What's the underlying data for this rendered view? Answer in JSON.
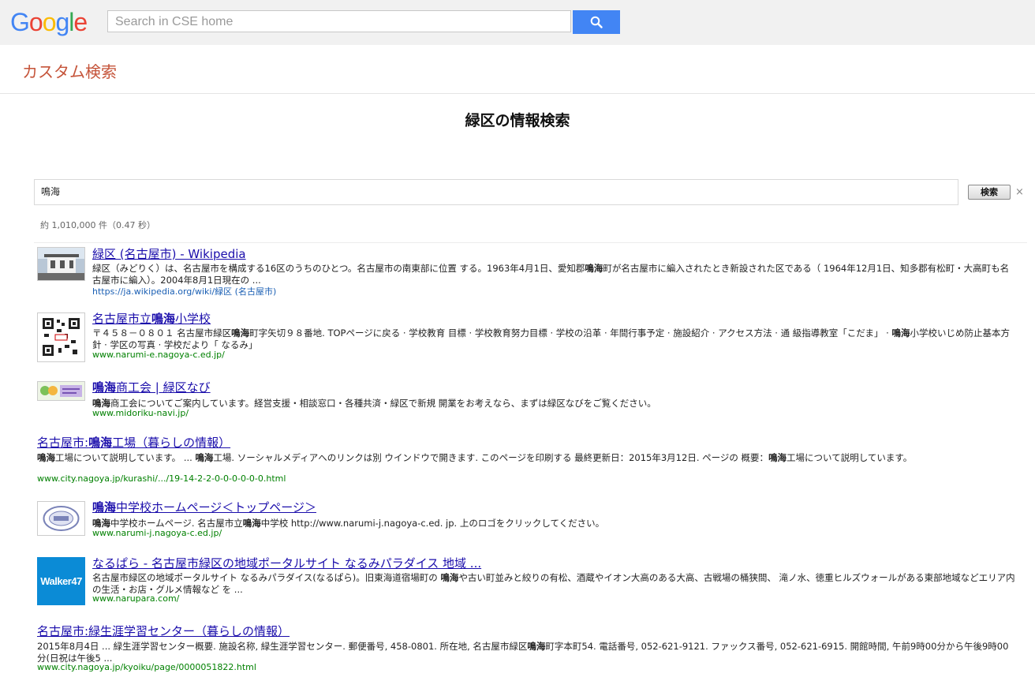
{
  "topbar": {
    "logo_letters": [
      {
        "ch": "G",
        "color": "#4285f4"
      },
      {
        "ch": "o",
        "color": "#ea4335"
      },
      {
        "ch": "o",
        "color": "#fbbc05"
      },
      {
        "ch": "g",
        "color": "#4285f4"
      },
      {
        "ch": "l",
        "color": "#34a853"
      },
      {
        "ch": "e",
        "color": "#ea4335"
      }
    ],
    "search_placeholder": "Search in CSE home",
    "search_button_color": "#4285f4"
  },
  "header": {
    "title": "カスタム検索"
  },
  "page": {
    "heading": "緑区の情報検索",
    "query": "鳴海",
    "search_button": "検索",
    "clear": "×",
    "result_count": "約 1,010,000 件（0.47 秒）"
  },
  "results": [
    {
      "title": "緑区 (名古屋市) - Wikipedia",
      "snippet": "緑区（みどりく）は、名古屋市を構成する16区のうちのひとつ。名古屋市の南東部に位置 する。1963年4月1日、愛知郡鳴海町が名古屋市に編入されたとき新設された区である（ 1964年12月1日、知多郡有松町・大高町も名古屋市に編入）。2004年8月1日現在の ...",
      "url": "https://ja.wikipedia.org/wiki/緑区 (名古屋市)",
      "thumb": "photo"
    },
    {
      "title": "名古屋市立鳴海小学校",
      "snippet": "〒４５８－０８０１ 名古屋市緑区鳴海町字矢切９８番地. TOPページに戻る · 学校教育 目標 · 学校教育努力目標 · 学校の沿革 · 年間行事予定 · 施設紹介 · アクセス方法 · 通 級指導教室「こだま」 · 鳴海小学校いじめ防止基本方針 · 学区の写真 · 学校だより「 なるみ」",
      "url": "www.narumi-e.nagoya-c.ed.jp/",
      "thumb": "qr"
    },
    {
      "title": "鳴海商工会 | 緑区なび",
      "snippet": "鳴海商工会についてご案内しています。経営支援・相談窓口・各種共済・緑区で新規 開業をお考えなら、まずは緑区なびをご覧ください。",
      "url": "www.midoriku-navi.jp/",
      "thumb": "banner"
    },
    {
      "title": "名古屋市:鳴海工場（暮らしの情報）",
      "snippet": "鳴海工場について説明しています。 ... 鳴海工場. ソーシャルメディアへのリンクは別 ウインドウで開きます. このページを印刷する 最終更新日：2015年3月12日. ページの 概要：鳴海工場について説明しています。",
      "url": "www.city.nagoya.jp/kurashi/.../19-14-2-2-0-0-0-0-0-0.html",
      "thumb": ""
    },
    {
      "title": "鳴海中学校ホームページ＜トップページ＞",
      "snippet": "鳴海中学校ホームページ. 名古屋市立鳴海中学校 http://www.narumi-j.nagoya-c.ed. jp. 上のロゴをクリックしてください。",
      "url": "www.narumi-j.nagoya-c.ed.jp/",
      "thumb": "logo"
    },
    {
      "title": "なるぱら - 名古屋市緑区の地域ポータルサイト なるみパラダイス 地域 ...",
      "snippet": "名古屋市緑区の地域ポータルサイト なるみパラダイス(なるぱら)。旧東海道宿場町の 鳴海や古い町並みと絞りの有松、酒蔵やイオン大高のある大高、古戦場の桶狭間、 滝ノ水、徳重ヒルズウォールがある東部地域などエリア内の生活・お店・グルメ情報など を ...",
      "url": "www.narupara.com/",
      "thumb": "walker",
      "thumb_text": "Walker47"
    },
    {
      "title": "名古屋市:緑生涯学習センター（暮らしの情報）",
      "snippet": "2015年8月4日 ... 緑生涯学習センター概要. 施設名称, 緑生涯学習センター. 郵便番号, 458-0801. 所在地, 名古屋市緑区鳴海町字本町54. 電話番号, 052-621-9121. ファックス番号, 052-621-6915. 開館時間, 午前9時00分から午後9時00分(日祝は午後5 ...",
      "url": "www.city.nagoya.jp/kyoiku/page/0000051822.html",
      "thumb": ""
    }
  ]
}
